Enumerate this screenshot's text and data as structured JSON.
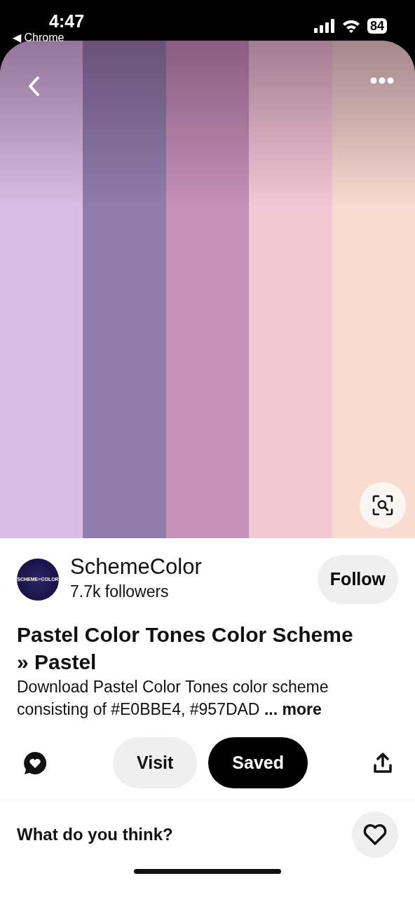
{
  "status_bar": {
    "time": "4:47",
    "back_app": "◀ Chrome",
    "battery": "84"
  },
  "palette": [
    {
      "color": "#d9bde4"
    },
    {
      "color": "#8f7dab"
    },
    {
      "color": "#c691b9"
    },
    {
      "color": "#f4c9d6"
    },
    {
      "color": "#f9dcd0"
    }
  ],
  "creator": {
    "logo_text": "SCHEME≡COLOR",
    "name": "SchemeColor",
    "followers": "7.7k followers",
    "follow_label": "Follow"
  },
  "pin": {
    "title": "Pastel Color Tones Color Scheme » Pastel",
    "description": "Download Pastel Color Tones color scheme consisting of #E0BBE4, #957DAD",
    "more": "... more"
  },
  "actions": {
    "visit_label": "Visit",
    "save_label": "Saved",
    "saved": true
  },
  "comment_prompt": "What do you think?"
}
